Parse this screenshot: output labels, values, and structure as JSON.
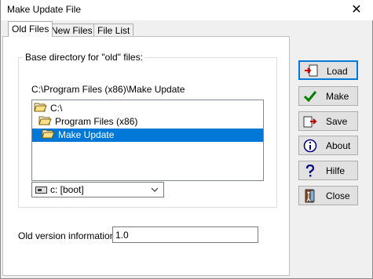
{
  "window": {
    "title": "Make Update File",
    "close_glyph": "✕"
  },
  "tabs": [
    {
      "label": "Old Files",
      "active": true
    },
    {
      "label": "New Files",
      "active": false
    },
    {
      "label": "File List",
      "active": false
    }
  ],
  "group": {
    "legend": "Base directory for \"old\" files:",
    "current_path": "C:\\Program Files (x86)\\Make Update"
  },
  "directory_list": [
    {
      "label": "C:\\",
      "icon": "folder-open-icon",
      "selected": false
    },
    {
      "label": "Program Files (x86)",
      "icon": "folder-open-icon",
      "selected": false
    },
    {
      "label": "Make Update",
      "icon": "folder-open-icon",
      "selected": true
    }
  ],
  "drive": {
    "value": "c: [boot]",
    "icon": "drive-icon"
  },
  "version": {
    "label": "Old version information:",
    "value": "1.0"
  },
  "buttons": [
    {
      "label": "Load",
      "icon": "load-icon",
      "default": true
    },
    {
      "label": "Make",
      "icon": "checkmark-icon",
      "default": false
    },
    {
      "label": "Save",
      "icon": "save-icon",
      "default": false
    },
    {
      "label": "About",
      "icon": "info-icon",
      "default": false
    },
    {
      "label": "Hilfe",
      "icon": "help-icon",
      "default": false
    },
    {
      "label": "Close",
      "icon": "exit-door-icon",
      "default": false
    }
  ],
  "colors": {
    "selection": "#0078d7",
    "window_bg": "#f0f0f0"
  }
}
